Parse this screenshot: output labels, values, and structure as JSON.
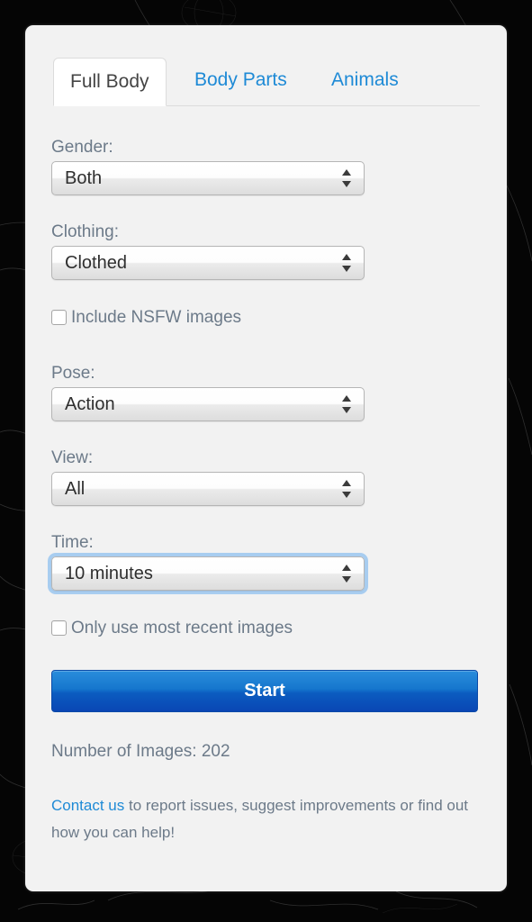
{
  "background": {
    "color": "#050505",
    "texture": "faint-scratch-lines"
  },
  "panel": {
    "background": "#f2f2f2"
  },
  "tabs": [
    {
      "id": "full-body",
      "label": "Full Body",
      "active": true
    },
    {
      "id": "body-parts",
      "label": "Body Parts",
      "active": false
    },
    {
      "id": "animals",
      "label": "Animals",
      "active": false
    }
  ],
  "form": {
    "gender": {
      "label": "Gender:",
      "value": "Both",
      "focused": false
    },
    "clothing": {
      "label": "Clothing:",
      "value": "Clothed",
      "focused": false
    },
    "pose": {
      "label": "Pose:",
      "value": "Action",
      "focused": false
    },
    "view": {
      "label": "View:",
      "value": "All",
      "focused": false
    },
    "time": {
      "label": "Time:",
      "value": "10 minutes",
      "focused": true
    }
  },
  "checkboxes": {
    "nsfw": {
      "label": "Include NSFW images",
      "checked": false
    },
    "recent": {
      "label": "Only use most recent images",
      "checked": false
    }
  },
  "start_button": {
    "label": "Start"
  },
  "footer": {
    "image_count": "Number of Images: 202",
    "contact_link": "Contact us",
    "contact_rest": " to report issues, suggest improvements or find out how you can help!"
  },
  "colors": {
    "link_blue": "#1e8ad6",
    "label_gray": "#6c7a89",
    "focus_ring": "#a8cdf0",
    "button_blue_top": "#2a8ddc",
    "button_blue_bottom": "#0a46b4"
  }
}
